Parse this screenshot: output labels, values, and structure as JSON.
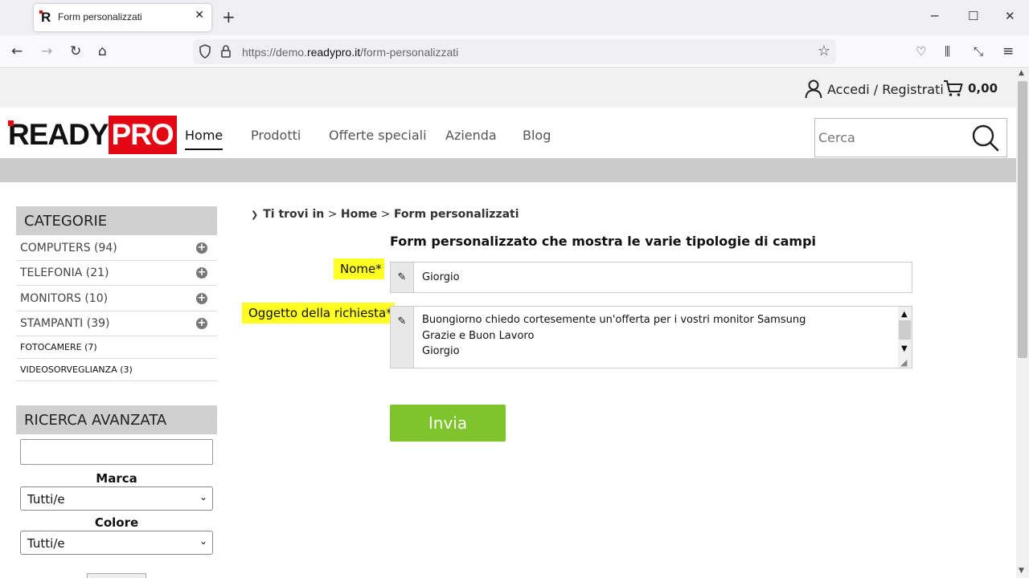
{
  "browser": {
    "tab_title": "Form personalizzati",
    "tab_logo": "R",
    "url_prefix": "https://demo.",
    "url_domain": "readypro.it",
    "url_path": "/form-personalizzati"
  },
  "topbar": {
    "login_label": "Accedi / Registrati",
    "cart_total": "0,00"
  },
  "header": {
    "logo_ready": "READY",
    "logo_pro": "PRO",
    "menu": [
      "Home",
      "Prodotti",
      "Offerte speciali",
      "Azienda",
      "Blog"
    ],
    "search_placeholder": "Cerca"
  },
  "sidebar": {
    "categories_title": "CATEGORIE",
    "categories": [
      {
        "label": "COMPUTERS (94)",
        "expandable": true
      },
      {
        "label": "TELEFONIA (21)",
        "expandable": true
      },
      {
        "label": "MONITORS (10)",
        "expandable": true
      },
      {
        "label": "STAMPANTI (39)",
        "expandable": true
      },
      {
        "label": "FOTOCAMERE (7)",
        "expandable": false
      },
      {
        "label": "VIDEOSORVEGLIANZA (3)",
        "expandable": false
      }
    ],
    "advanced_title": "RICERCA AVANZATA",
    "brand_label": "Marca",
    "brand_value": "Tutti/e",
    "color_label": "Colore",
    "color_value": "Tutti/e"
  },
  "breadcrumb": {
    "prefix": "Ti trovi in",
    "home": "Home",
    "current": "Form personalizzati",
    "sep": ">"
  },
  "form": {
    "title": "Form personalizzato che mostra le varie tipologie di campi",
    "name_label": "Nome*",
    "name_value": "Giorgio",
    "message_label": "Oggetto della richiesta*",
    "message_lines": [
      "Buongiorno chiedo cortesemente un'offerta per i vostri monitor Samsung",
      "Grazie e Buon Lavoro",
      "Giorgio"
    ],
    "submit_label": "Invia"
  },
  "colors": {
    "brand_red": "#e30613",
    "submit_green": "#7dc52a",
    "label_highlight": "#ffff22"
  }
}
